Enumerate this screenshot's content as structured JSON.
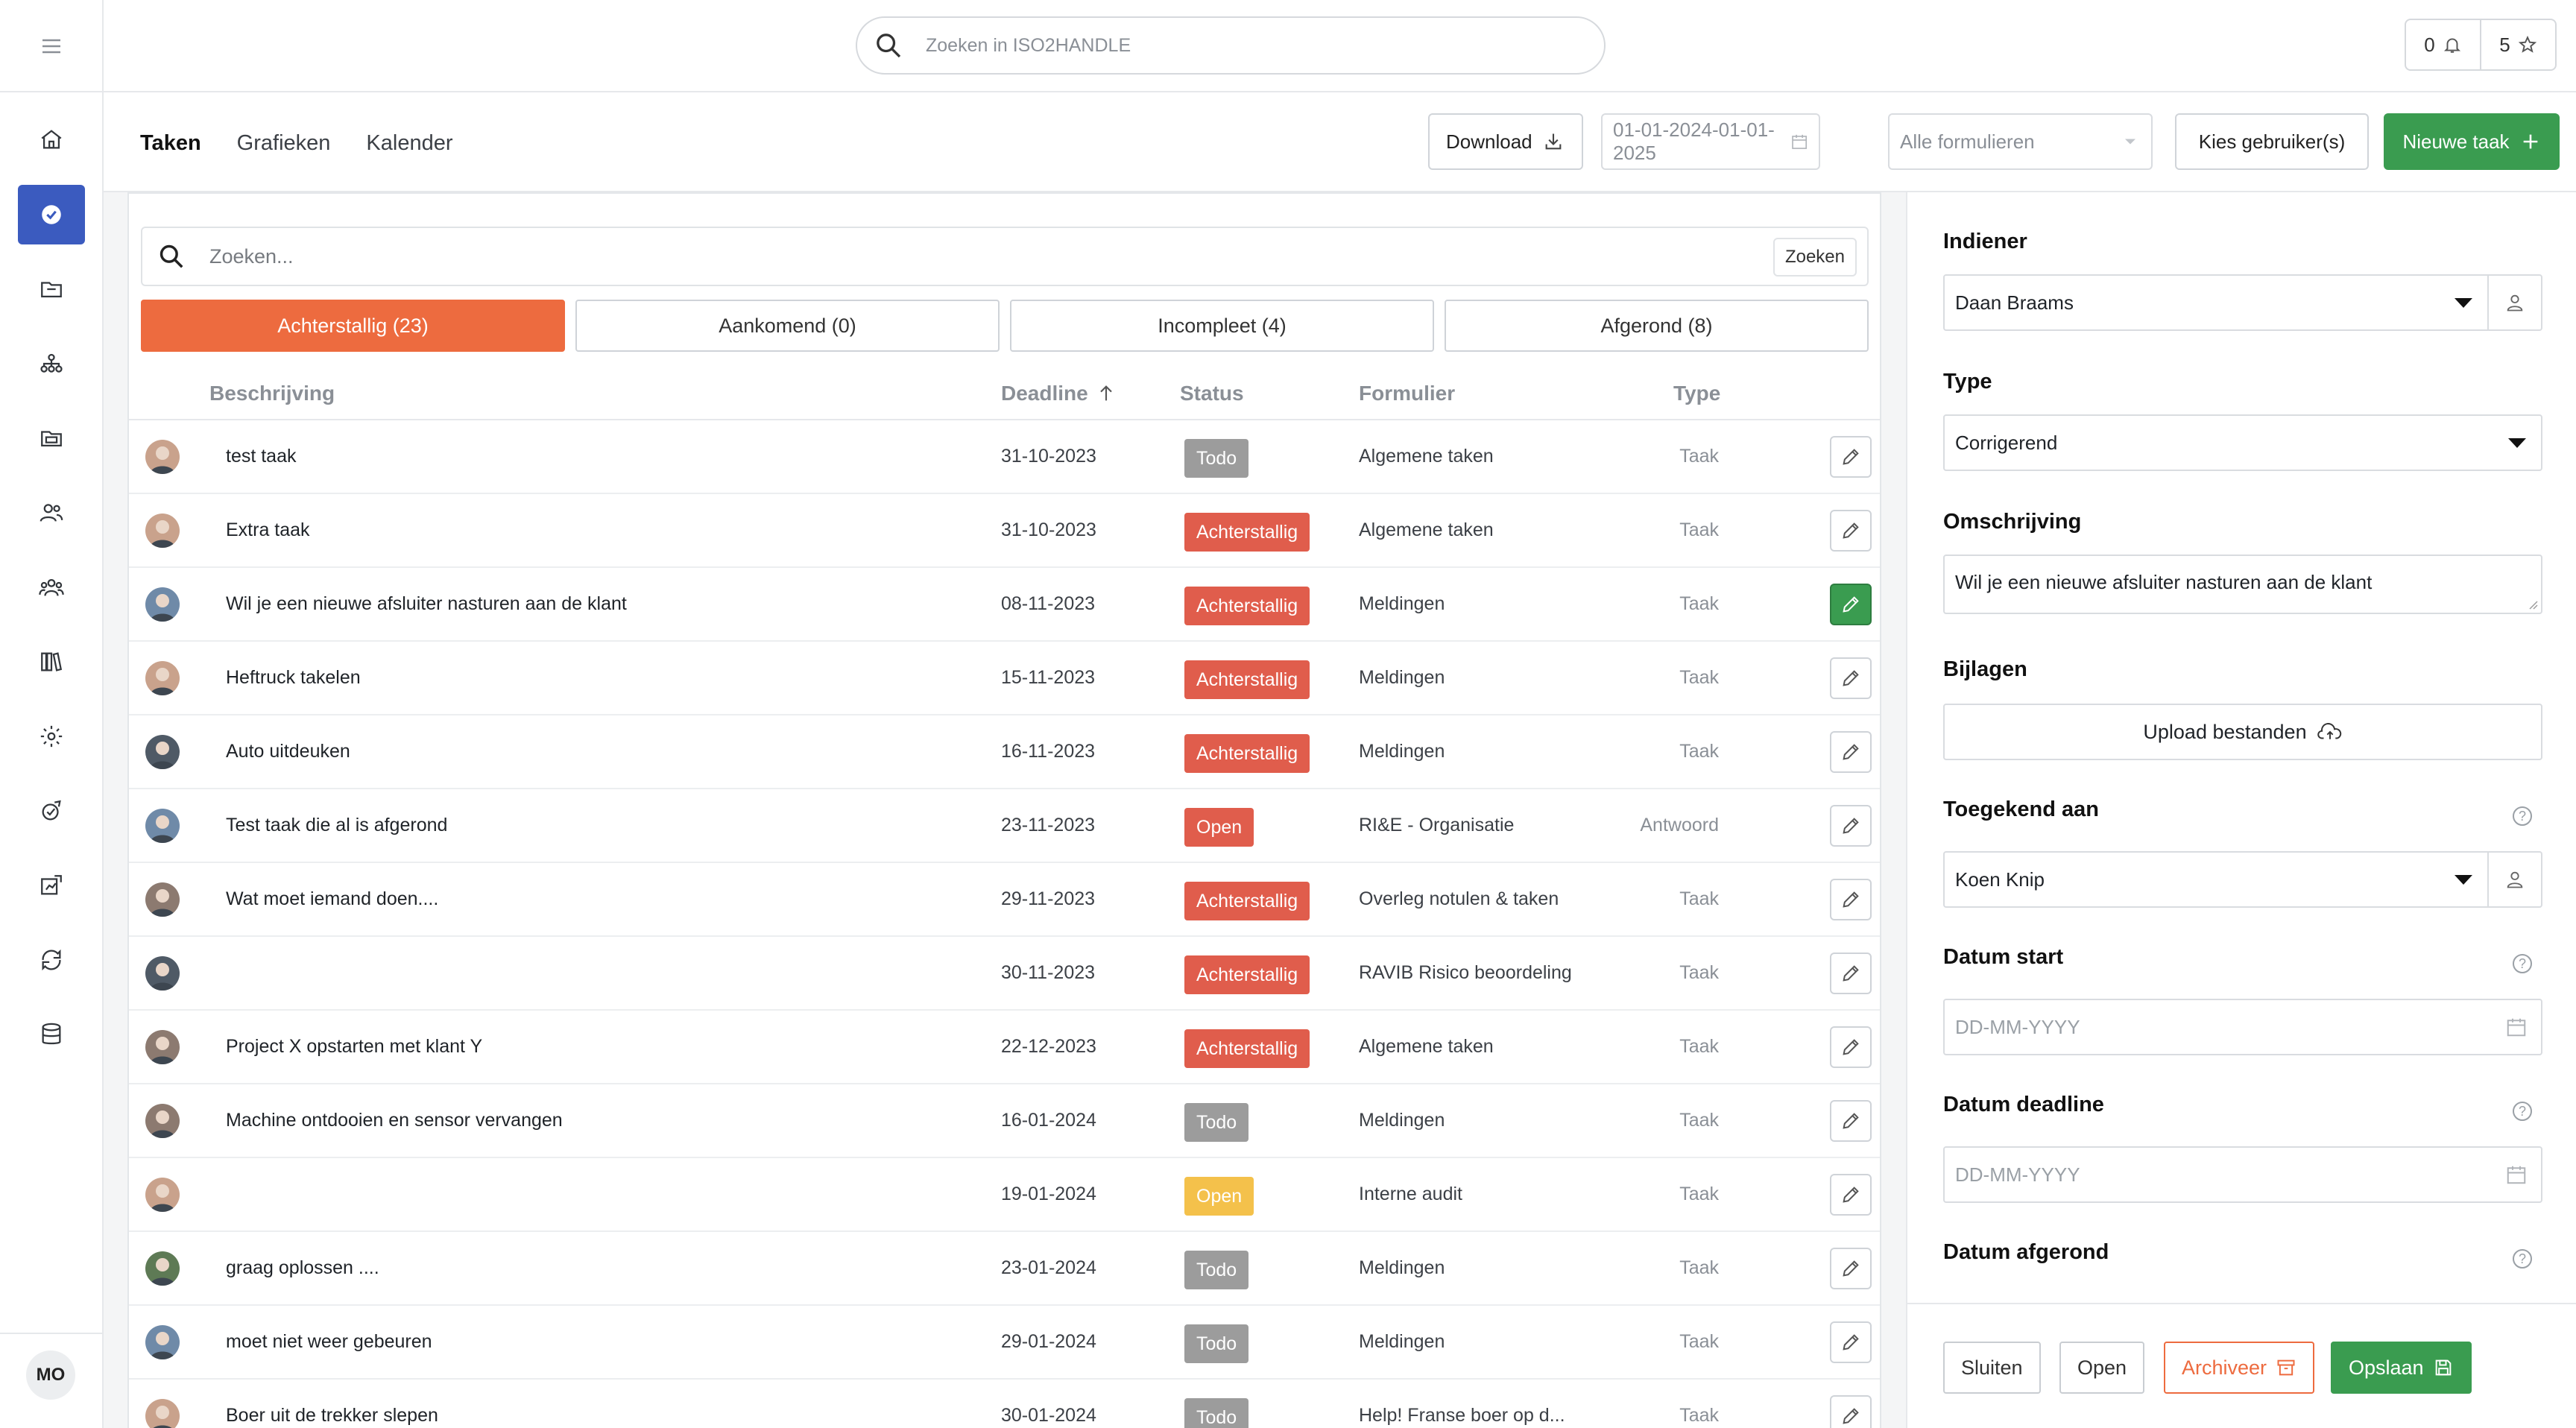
{
  "app": {
    "search_placeholder": "Zoeken in ISO2HANDLE",
    "notifications_count": "0",
    "favorites_count": "5",
    "user_initials": "MO"
  },
  "nav": {
    "items": [
      "home",
      "tasks",
      "documents",
      "organisation",
      "folders",
      "users",
      "teams",
      "library",
      "settings",
      "audit",
      "reports",
      "cycle",
      "database"
    ]
  },
  "tabs": {
    "taken": "Taken",
    "grafieken": "Grafieken",
    "kalender": "Kalender"
  },
  "toolbar": {
    "download": "Download",
    "date_range": "01-01-2024-01-01-2025",
    "form_select": "Alle formulieren",
    "choose_users": "Kies gebruiker(s)",
    "new_task": "Nieuwe taak"
  },
  "list": {
    "search_placeholder": "Zoeken...",
    "search_button": "Zoeken",
    "filters": {
      "overdue": "Achterstallig (23)",
      "upcoming": "Aankomend (0)",
      "incomplete": "Incompleet (4)",
      "done": "Afgerond (8)"
    },
    "columns": {
      "description": "Beschrijving",
      "deadline": "Deadline",
      "status": "Status",
      "form": "Formulier",
      "type": "Type"
    },
    "rows": [
      {
        "desc": "test taak",
        "deadline": "31-10-2023",
        "status": "Todo",
        "status_kind": "todo",
        "form": "Algemene taken",
        "type": "Taak",
        "avatar": "#c9a28c",
        "selected": false
      },
      {
        "desc": "Extra taak",
        "deadline": "31-10-2023",
        "status": "Achterstallig",
        "status_kind": "achter",
        "form": "Algemene taken",
        "type": "Taak",
        "avatar": "#c9a28c",
        "selected": false
      },
      {
        "desc": "Wil je een nieuwe afsluiter nasturen aan de klant",
        "deadline": "08-11-2023",
        "status": "Achterstallig",
        "status_kind": "achter",
        "form": "Meldingen",
        "type": "Taak",
        "avatar": "#6f8aa8",
        "selected": true
      },
      {
        "desc": "Heftruck takelen",
        "deadline": "15-11-2023",
        "status": "Achterstallig",
        "status_kind": "achter",
        "form": "Meldingen",
        "type": "Taak",
        "avatar": "#c9a28c",
        "selected": false
      },
      {
        "desc": "Auto uitdeuken",
        "deadline": "16-11-2023",
        "status": "Achterstallig",
        "status_kind": "achter",
        "form": "Meldingen",
        "type": "Taak",
        "avatar": "#4f5a66",
        "selected": false
      },
      {
        "desc": "Test taak die al is afgerond",
        "deadline": "23-11-2023",
        "status": "Open",
        "status_kind": "open-red",
        "form": "RI&E - Organisatie",
        "type": "Antwoord",
        "avatar": "#6f8aa8",
        "selected": false
      },
      {
        "desc": "Wat moet iemand doen....",
        "deadline": "29-11-2023",
        "status": "Achterstallig",
        "status_kind": "achter",
        "form": "Overleg notulen & taken",
        "type": "Taak",
        "avatar": "#8c7a70",
        "selected": false
      },
      {
        "desc": "",
        "deadline": "30-11-2023",
        "status": "Achterstallig",
        "status_kind": "achter",
        "form": "RAVIB Risico beoordeling",
        "type": "Taak",
        "avatar": "#4f5a66",
        "selected": false
      },
      {
        "desc": "Project X opstarten met klant Y",
        "deadline": "22-12-2023",
        "status": "Achterstallig",
        "status_kind": "achter",
        "form": "Algemene taken",
        "type": "Taak",
        "avatar": "#8c7a70",
        "selected": false
      },
      {
        "desc": "Machine ontdooien en sensor vervangen",
        "deadline": "16-01-2024",
        "status": "Todo",
        "status_kind": "todo",
        "form": "Meldingen",
        "type": "Taak",
        "avatar": "#8c7a70",
        "selected": false
      },
      {
        "desc": "",
        "deadline": "19-01-2024",
        "status": "Open",
        "status_kind": "open-yellow",
        "form": "Interne audit",
        "type": "Taak",
        "avatar": "#c9a28c",
        "selected": false
      },
      {
        "desc": "graag oplossen ....",
        "deadline": "23-01-2024",
        "status": "Todo",
        "status_kind": "todo",
        "form": "Meldingen",
        "type": "Taak",
        "avatar": "#5e7a55",
        "selected": false
      },
      {
        "desc": "moet niet weer gebeuren",
        "deadline": "29-01-2024",
        "status": "Todo",
        "status_kind": "todo",
        "form": "Meldingen",
        "type": "Taak",
        "avatar": "#6f8aa8",
        "selected": false
      },
      {
        "desc": "Boer uit de trekker slepen",
        "deadline": "30-01-2024",
        "status": "Todo",
        "status_kind": "todo",
        "form": "Help! Franse boer op d...",
        "type": "Taak",
        "avatar": "#c9a28c",
        "selected": false
      }
    ]
  },
  "detail": {
    "submitter_label": "Indiener",
    "submitter_value": "Daan Braams",
    "type_label": "Type",
    "type_value": "Corrigerend",
    "description_label": "Omschrijving",
    "description_value": "Wil je een nieuwe afsluiter nasturen aan de klant",
    "attachments_label": "Bijlagen",
    "upload_label": "Upload bestanden",
    "assigned_label": "Toegekend aan",
    "assigned_value": "Koen Knip",
    "start_label": "Datum start",
    "start_placeholder": "DD-MM-YYYY",
    "deadline_label": "Datum deadline",
    "deadline_placeholder": "DD-MM-YYYY",
    "completed_label": "Datum afgerond",
    "help_glyph": "?"
  },
  "footer": {
    "close": "Sluiten",
    "open": "Open",
    "archive": "Archiveer",
    "save": "Opslaan"
  },
  "colors": {
    "accent_blue": "#3b5bbf",
    "overdue_orange": "#ed6b3f",
    "status_red": "#e05d4c",
    "status_gray": "#9c9c9c",
    "status_yellow": "#f4c14b",
    "green": "#3a9c50"
  }
}
